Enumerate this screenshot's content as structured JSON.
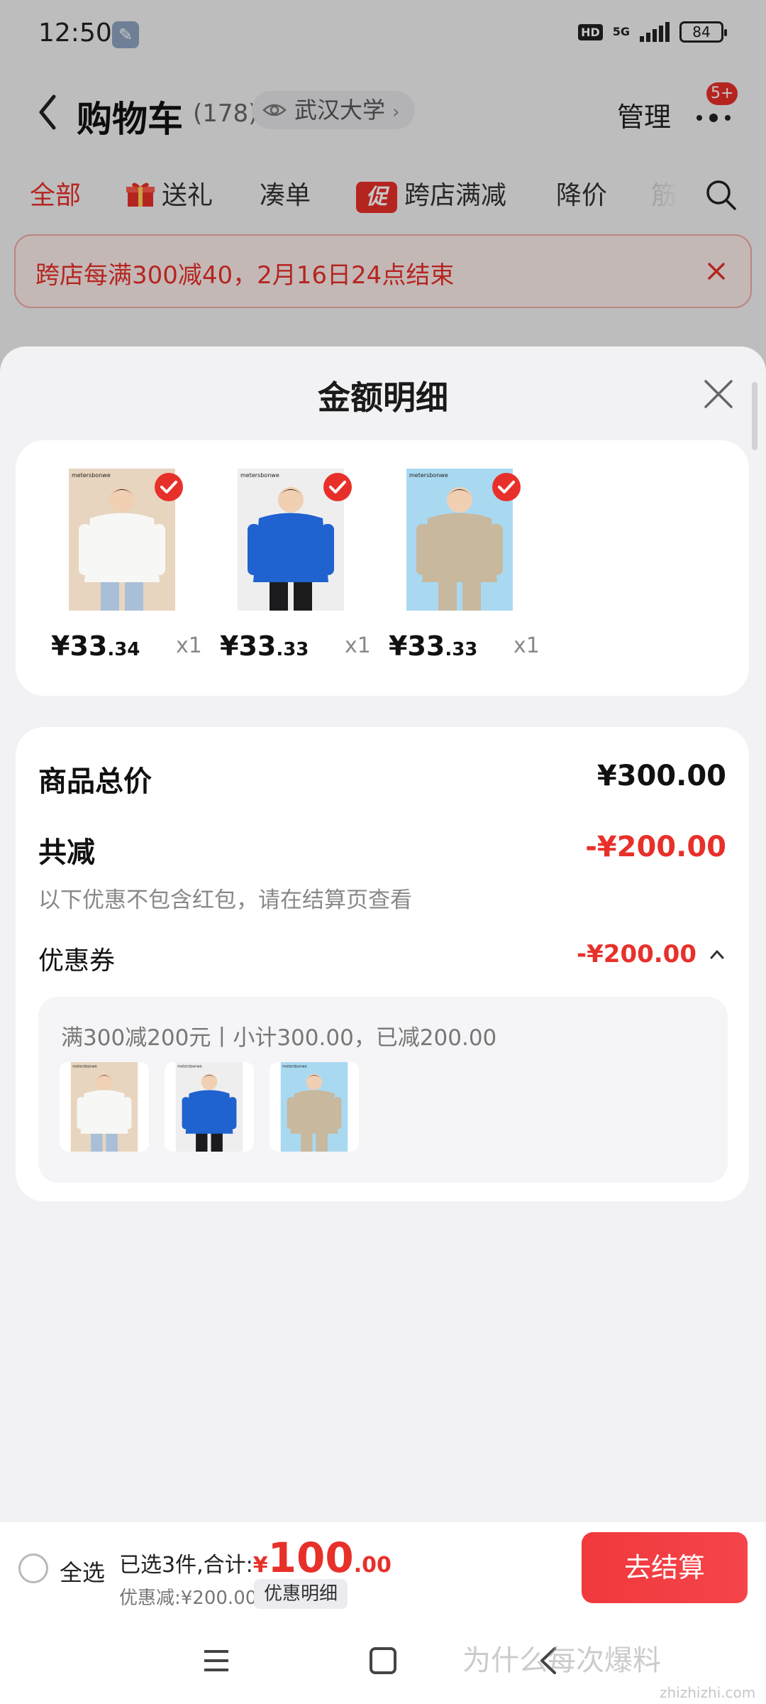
{
  "status_bar": {
    "time": "12:50",
    "hd": "HD",
    "network": "5G",
    "battery": "84"
  },
  "header": {
    "title": "购物车",
    "count": "(178)",
    "location": "武汉大学",
    "manage": "管理",
    "badge": "5+"
  },
  "tabs": [
    "全部",
    "送礼",
    "凑单",
    "跨店满减",
    "降价",
    "筋"
  ],
  "promo_badge": "促",
  "banner": {
    "text": "跨店每满300减40，2月16日24点结束"
  },
  "sheet": {
    "title": "金额明细",
    "products": [
      {
        "price_int": "¥33",
        "price_dec": ".34",
        "qty": "x1",
        "brand": "metersbonwe",
        "colors": {
          "bg": "#e8d5bf",
          "top": "#f7f7f5",
          "pants": "#a9bfd8"
        }
      },
      {
        "price_int": "¥33",
        "price_dec": ".33",
        "qty": "x1",
        "brand": "metersbonwe",
        "colors": {
          "bg": "#eeeeee",
          "top": "#1f62d0",
          "pants": "#1b1b1d"
        }
      },
      {
        "price_int": "¥33",
        "price_dec": ".33",
        "qty": "x1",
        "brand": "metersbonwe",
        "colors": {
          "bg": "#a9d9f1",
          "top": "#c8b89e",
          "pants": "#c8b89e"
        }
      }
    ],
    "total_label": "商品总价",
    "total_value": "¥300.00",
    "discount_label": "共减",
    "discount_value": "-¥200.00",
    "discount_note": "以下优惠不包含红包，请在结算页查看",
    "coupon_label": "优惠券",
    "coupon_value": "-¥200.00",
    "coupon_desc": "满300减200元丨小计300.00，已减200.00"
  },
  "bottom_bar": {
    "select_all": "全选",
    "selected_text": "已选3件,合计:",
    "total_symbol": "¥",
    "total_int": "100",
    "total_dec": ".00",
    "discount_text": "优惠减:¥200.00",
    "discount_detail": "优惠明细",
    "checkout": "去结算"
  },
  "watermark": {
    "text": "为什么每次爆料",
    "sub": "zhizhizhi.com"
  },
  "colors": {
    "accent": "#e8302a",
    "sheet_bg": "#f2f2f4",
    "card_bg": "#ffffff"
  }
}
